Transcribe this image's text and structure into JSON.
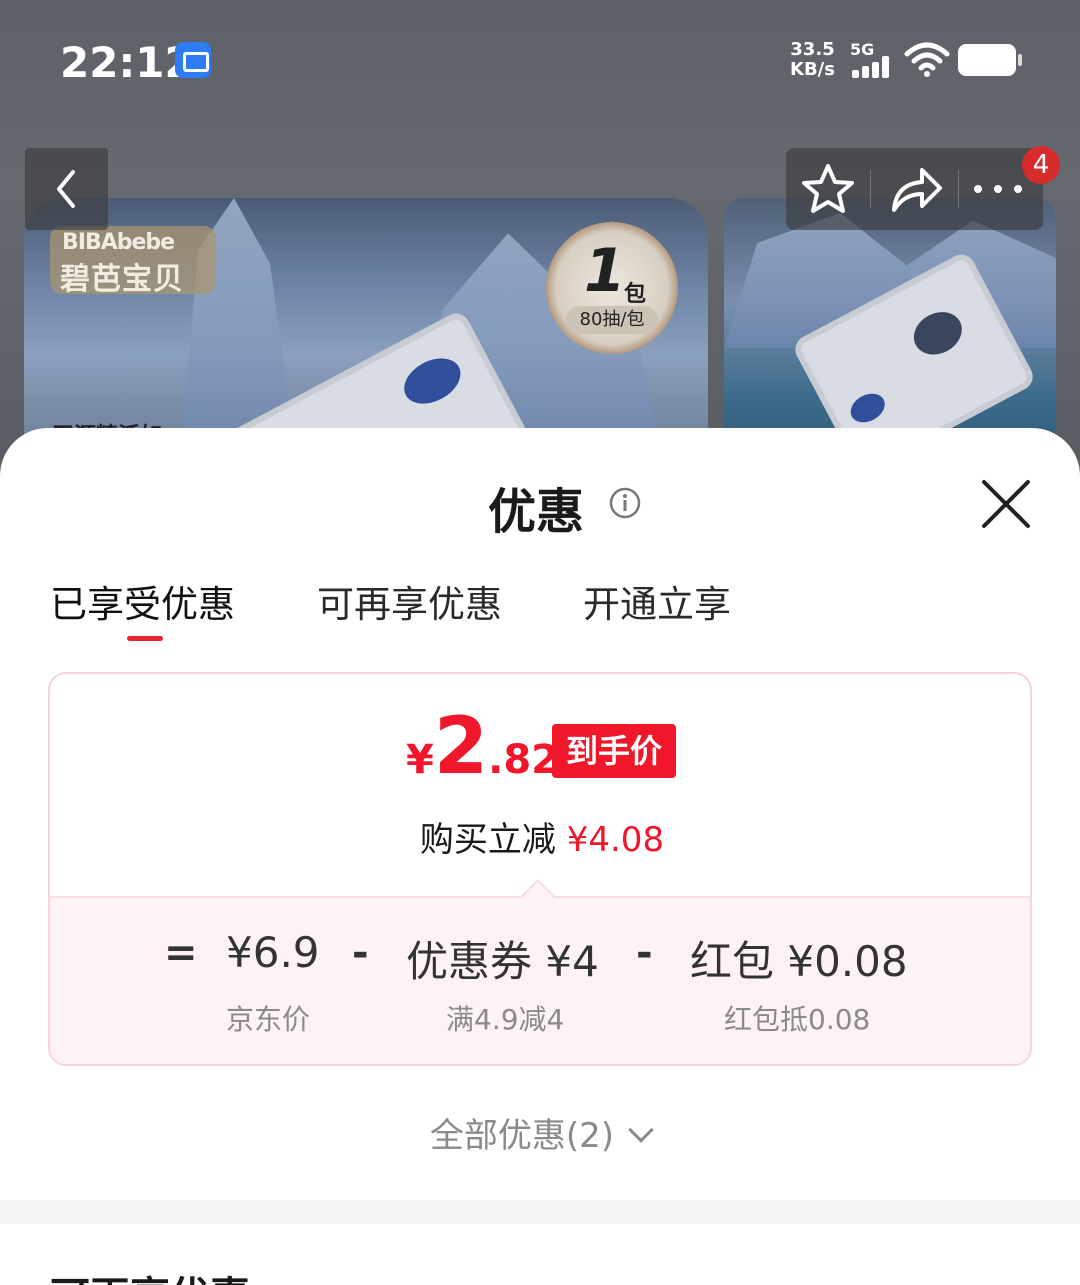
{
  "status_bar": {
    "time": "22:12",
    "net_speed_value": "33.5",
    "net_speed_unit": "KB/s",
    "network": "5G",
    "icons": [
      "screenshot-app-icon",
      "signal-icon",
      "wifi-icon",
      "battery-icon"
    ]
  },
  "background": {
    "brand_en": "BIBAbebe",
    "brand_cn": "碧芭宝贝",
    "pack_count": "1",
    "pack_unit": "包",
    "pack_spec": "80抽/包",
    "peek_text": "天源精活如",
    "cart_count": "4"
  },
  "sheet": {
    "title": "优惠",
    "tabs": [
      {
        "label": "已享受优惠",
        "active": true
      },
      {
        "label": "可再享优惠",
        "active": false
      },
      {
        "label": "开通立享",
        "active": false
      }
    ],
    "price": {
      "currency": "¥",
      "integer": "2",
      "decimal": ".82",
      "tag": "到手价",
      "saving_label": "购买立减",
      "saving_amount": "¥4.08"
    },
    "formula": {
      "equals": "=",
      "minus": "-",
      "items": [
        {
          "value": "¥6.9",
          "label": "京东价"
        },
        {
          "value": "优惠券 ¥4",
          "label": "满4.9减4"
        },
        {
          "value": "红包 ¥0.08",
          "label": "红包抵0.08"
        }
      ]
    },
    "all_offers": "全部优惠(2)",
    "next_section_title": "可再享优惠"
  },
  "colors": {
    "accent_red": "#f0172b",
    "card_border": "#f8d5dc",
    "card_bottom_bg": "#fdf3f5"
  }
}
